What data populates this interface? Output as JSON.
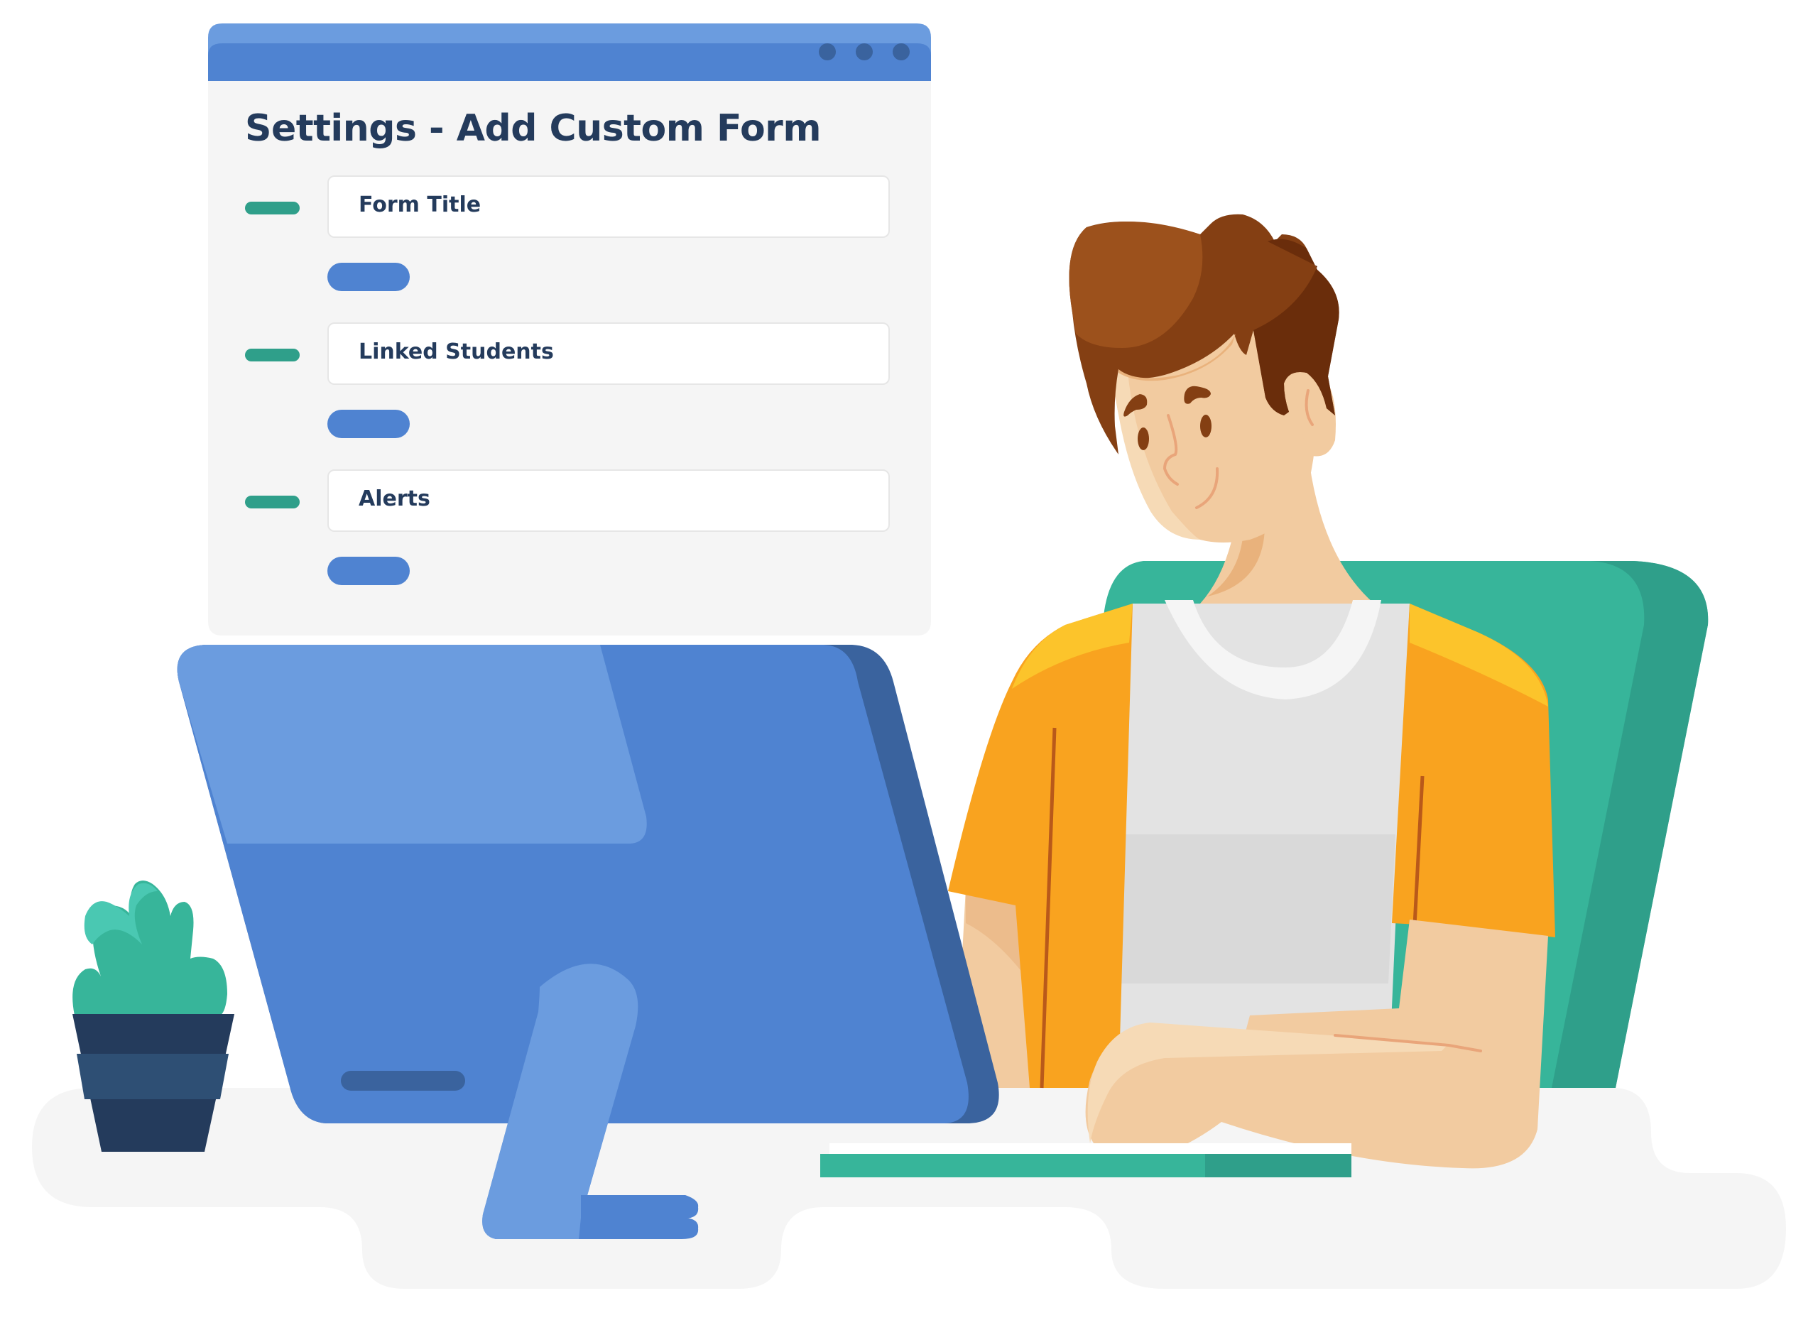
{
  "window": {
    "title": "Settings - Add Custom Form",
    "controls": [
      "window-dot-1",
      "window-dot-2",
      "window-dot-3"
    ],
    "fields": [
      {
        "label": "Form Title"
      },
      {
        "label": "Linked Students"
      },
      {
        "label": "Alerts"
      }
    ]
  },
  "colors": {
    "titlebar": "#4f83d1",
    "titlebar_light": "#6b9cdf",
    "window_bg": "#f5f5f5",
    "text_dark": "#243b5c",
    "accent_green": "#2f9f8a",
    "accent_blue": "#4f83d1",
    "monitor_dark": "#3a639e",
    "chair": "#37b59a",
    "shirt_orange": "#f9a31f",
    "hair": "#843f13"
  },
  "illustration": {
    "scene": "person-at-desk-with-monitor",
    "elements": [
      "monitor",
      "plant",
      "person",
      "chair",
      "keyboard",
      "desk-floor"
    ]
  }
}
